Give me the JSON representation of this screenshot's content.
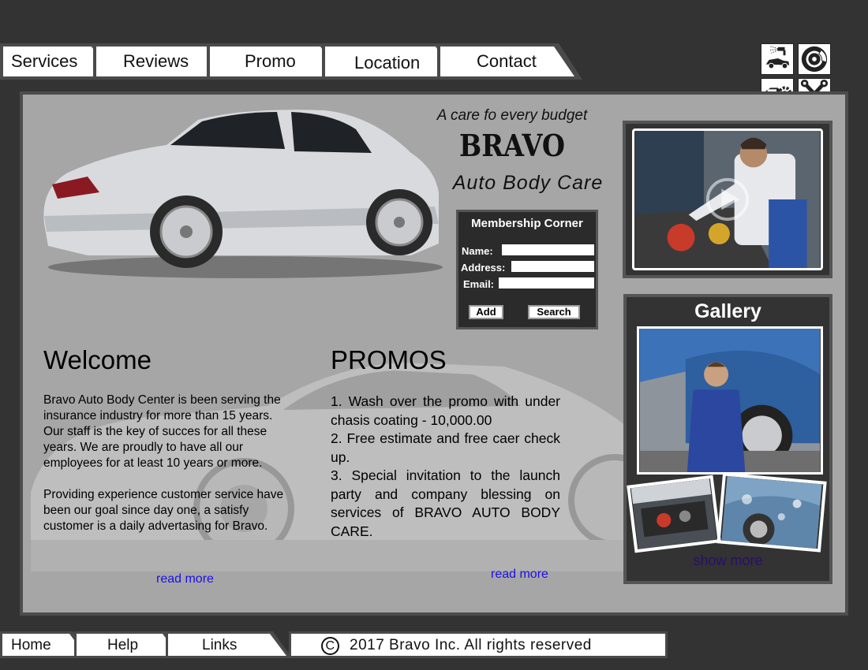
{
  "nav": {
    "tabs": [
      {
        "label": "Services"
      },
      {
        "label": "Reviews"
      },
      {
        "label": "Promo"
      },
      {
        "label": "Location"
      },
      {
        "label": "Contact"
      }
    ]
  },
  "icons": [
    "car-spray-icon",
    "brake-disc-icon",
    "car-gear-icon",
    "wrench-tools-icon"
  ],
  "header": {
    "tagline": "A care fo every budget",
    "brand": "BRAVO",
    "subbrand": "Auto Body Care"
  },
  "membership": {
    "title": "Membership Corner",
    "name_label": "Name:",
    "address_label": "Address:",
    "email_label": "Email:",
    "name_value": "",
    "address_value": "",
    "email_value": "",
    "add_label": "Add",
    "search_label": "Search"
  },
  "welcome": {
    "heading": "Welcome",
    "paragraph1": "Bravo Auto Body Center is been serving the insurance industry for more than 15 years. Our staff is the key of succes for all these years. We are proudly to have all our employees for at least 10 years or more.",
    "paragraph2": "Providing experience customer service have been our goal since day one, a satisfy customer is a daily advertasing for Bravo.",
    "read_more": "read more"
  },
  "promos": {
    "heading": "PROMOS",
    "items": [
      "1. Wash over the promo with under chasis coating - 10,000.00",
      "2. Free estimate and free caer check up.",
      "3. Special invitation to the launch party and company blessing on services of BRAVO AUTO BODY CARE."
    ],
    "read_more": "read more"
  },
  "gallery": {
    "title": "Gallery",
    "show_more": "show more"
  },
  "footer": {
    "links": [
      {
        "label": "Home"
      },
      {
        "label": "Help"
      },
      {
        "label": "Links"
      }
    ],
    "copyright_symbol": "C",
    "copyright_text": "2017 Bravo Inc. All rights reserved"
  },
  "colors": {
    "page_bg": "#333333",
    "panel_bg": "#a7a6a7",
    "link": "#1a10e6",
    "show_more": "#2a0e6a"
  }
}
